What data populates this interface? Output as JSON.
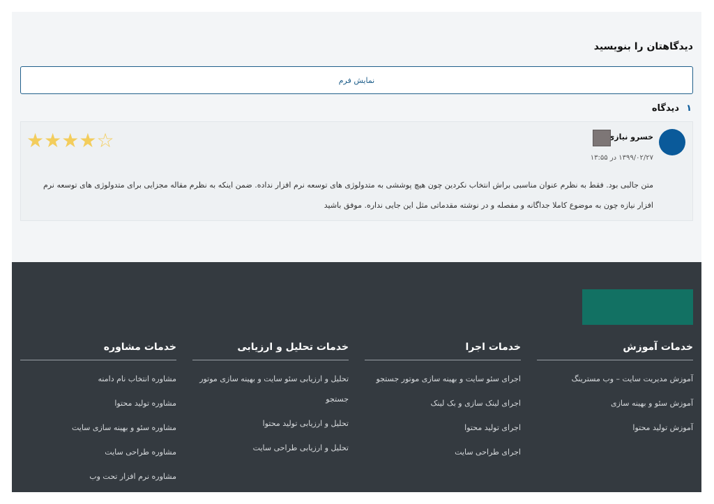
{
  "comments": {
    "heading": "دیدگاهتان را بنویسید",
    "show_form_label": "نمایش فرم",
    "count_number": "۱",
    "count_label": "دیدگاه",
    "items": [
      {
        "author": "خسرو نیازی",
        "date": "۱۳۹۹/۰۲/۲۷ در ۱۳:۵۵",
        "rating": 4,
        "rating_max": 5,
        "text": "متن جالبی بود. فقط به نظرم عنوان مناسبی براش انتخاب نکردین چون هیچ پوششی به متدولوژی های توسعه نرم افزار نداده. ضمن اینکه به نظرم مقاله مجزایی برای متدولوژی های توسعه نرم افزار نیازه چون به موضوع کاملا جداگانه و مفصله و در نوشته مقدماتی مثل این جایی نداره. موفق باشید"
      }
    ]
  },
  "colors": {
    "accent": "#1f5f8b",
    "avatar": "#0a5a9a",
    "footer_bg": "#343a40",
    "logo": "#127163",
    "star": "#f3cd5c"
  },
  "footer": {
    "columns": [
      {
        "title": "خدمات آموزش",
        "links": [
          "آموزش مدیریت سایت – وب مسترینگ",
          "آموزش سئو و بهینه سازی",
          "آموزش تولید محتوا"
        ]
      },
      {
        "title": "خدمات اجرا",
        "links": [
          "اجرای سئو سایت و بهینه سازی موتور جستجو",
          "اجرای لینک سازی و بک لینک",
          "اجرای تولید محتوا",
          "اجرای طراحی سایت"
        ]
      },
      {
        "title": "خدمات تحلیل و ارزیابی",
        "links": [
          "تحلیل و ارزیابی سئو سایت و بهینه سازی موتور جستجو",
          "تحلیل و ارزیابی تولید محتوا",
          "تحلیل و ارزیابی طراحی سایت"
        ]
      },
      {
        "title": "خدمات مشاوره",
        "links": [
          "مشاوره انتخاب نام دامنه",
          "مشاوره تولید محتوا",
          "مشاوره سئو و بهینه سازی سایت",
          "مشاوره طراحی سایت",
          "مشاوره نرم افزار تحت وب"
        ]
      }
    ]
  }
}
